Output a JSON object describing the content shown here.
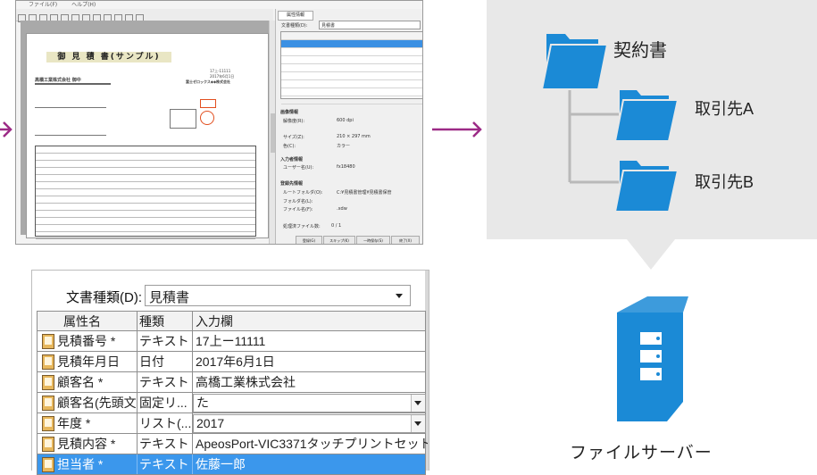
{
  "app_screenshot": {
    "menu": [
      "ファイル(F)",
      "ヘルプ(H)"
    ],
    "document": {
      "title": "御 見 積 書(サンプル)",
      "recipient": "高橋工業株式会社 御中",
      "sender": "富士ゼロックス◆◆株式会社",
      "estimate_no": "17上-11111",
      "estimate_date": "2017年6月1日"
    },
    "panel": {
      "tab": "属性情報",
      "doctype_label": "文書種類(D):",
      "doctype_value": "見積書",
      "image_info_label": "画像情報",
      "resolution_label": "解像度(R):",
      "resolution_value": "600 dpi",
      "size_label": "サイズ(Z):",
      "size_value": "210 × 297 mm",
      "color_label": "色(C):",
      "color_value": "カラー",
      "input_info_label": "入力者情報",
      "user_label": "ユーザー名(U):",
      "user_value": "fx18480",
      "dest_info_label": "登録先情報",
      "root_label": "ルートフォルダ(O):",
      "root_value": "C:¥見積書管理¥見積書保管",
      "folder_label": "フォルダ名(L):",
      "file_label": "ファイル名(F):",
      "file_value": ".xdw",
      "processed_label": "処理済ファイル数:",
      "processed_value": "0 / 1",
      "buttons": [
        "登録(G)",
        "スキップ(K)",
        "一時保存(S)",
        "終了(X)"
      ]
    }
  },
  "attribute_panel": {
    "doctype_label": "文書種類(D):",
    "doctype_value": "見積書",
    "headers": {
      "name": "属性名",
      "type": "種類",
      "input": "入力欄"
    },
    "rows": [
      {
        "name": "見積番号 *",
        "type": "テキスト",
        "value": "17上ー11111",
        "dropdown": false,
        "selected": false
      },
      {
        "name": "見積年月日",
        "type": "日付",
        "value": "2017年6月1日",
        "dropdown": false,
        "selected": false
      },
      {
        "name": "顧客名 *",
        "type": "テキスト",
        "value": "高橋工業株式会社",
        "dropdown": false,
        "selected": false
      },
      {
        "name": "顧客名(先頭文...",
        "type": "固定リ...",
        "value": "た",
        "dropdown": true,
        "selected": false
      },
      {
        "name": "年度 *",
        "type": "リスト(...",
        "value": "2017",
        "dropdown": true,
        "selected": false
      },
      {
        "name": "見積内容 *",
        "type": "テキスト",
        "value": "ApeosPort-VIC3371タッチプリントセット",
        "dropdown": false,
        "selected": false
      },
      {
        "name": "担当者 *",
        "type": "テキスト",
        "value": "佐藤一郎",
        "dropdown": false,
        "selected": true
      }
    ]
  },
  "diagram": {
    "root_folder": "契約書",
    "child_folders": [
      "取引先A",
      "取引先B"
    ],
    "server_label": "ファイルサーバー",
    "colors": {
      "folder": "#1b8ad6",
      "background": "#e8e8e8",
      "arrow": "#9c2a86",
      "tree_line": "#b9b9b9"
    }
  }
}
